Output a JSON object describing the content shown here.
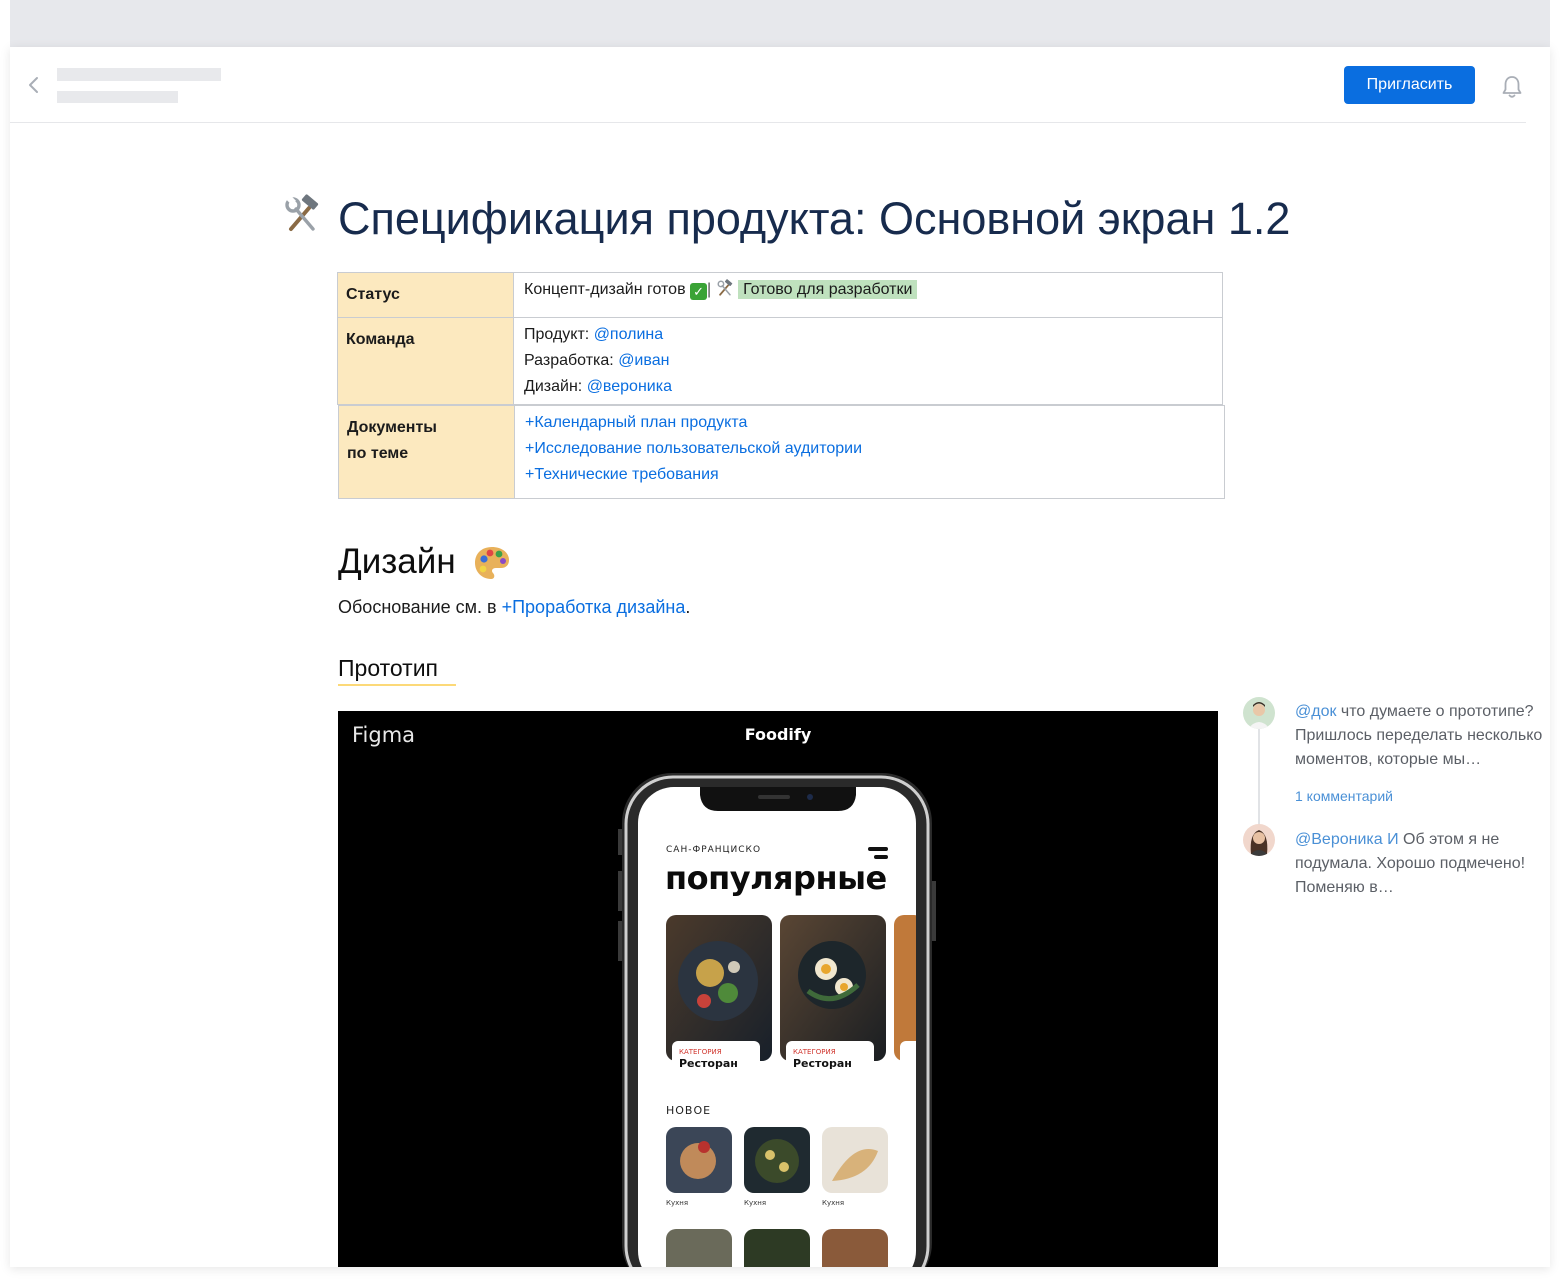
{
  "header": {
    "invite_label": "Пригласить"
  },
  "page": {
    "title": "Спецификация продукта: Основной экран 1.2"
  },
  "spec_table": {
    "status_label": "Статус",
    "status_text": "Концепт-дизайн готов",
    "status_separator": "|",
    "status_badge": "Готово для разработки",
    "team_label": "Команда",
    "team": [
      {
        "role": "Продукт:",
        "mention": "@полина"
      },
      {
        "role": "Разработка:",
        "mention": "@иван"
      },
      {
        "role": "Дизайн:",
        "mention": "@вероника"
      }
    ],
    "docs_label_line1": "Документы",
    "docs_label_line2": "по теме",
    "docs": [
      "+Календарный план продукта",
      "+Исследование пользовательской аудитории",
      "+Технические требования"
    ]
  },
  "design": {
    "heading": "Дизайн",
    "para_prefix": "Обоснование см. в ",
    "para_link": "+Проработка дизайна",
    "para_suffix": ".",
    "subheading": "Прототип"
  },
  "embed": {
    "brand": "Figma",
    "app_name": "Foodify",
    "phone": {
      "city": "САН-ФРАНЦИСКО",
      "headline": "популярные",
      "cards": [
        {
          "category": "КАТЕГОРИЯ",
          "name": "Ресторан"
        },
        {
          "category": "КАТЕГОРИЯ",
          "name": "Ресторан"
        }
      ],
      "section_new": "НОВОЕ",
      "new_items": [
        "Кухня",
        "Кухня",
        "Кухня"
      ]
    }
  },
  "comments": [
    {
      "mention": "@док",
      "text": " что думаете о прототипе? Пришлось переделать несколько моментов, которые мы…",
      "reply_count": "1 комментарий"
    },
    {
      "mention": "@Вероника И",
      "text": " Об этом я не подумала. Хорошо подмечено! Поменяю в…"
    }
  ],
  "colors": {
    "accent": "#0a6ee0",
    "label_bg": "#fce9bf",
    "badge_bg": "#bfe1be",
    "link": "#0a6ee0",
    "underline": "#fcd978"
  }
}
